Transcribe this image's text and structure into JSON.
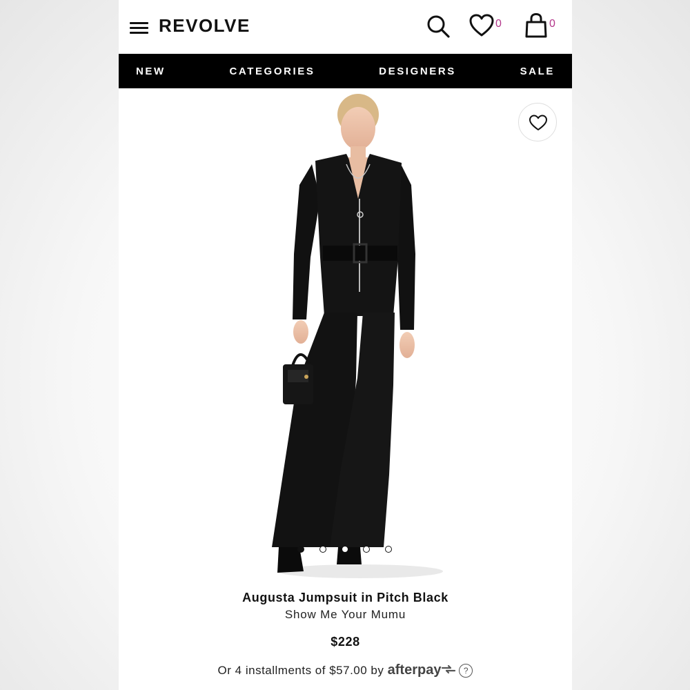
{
  "header": {
    "logo": "REVOLVE",
    "wishlist_count": "0",
    "bag_count": "0",
    "icons": [
      "menu-icon",
      "search-icon",
      "heart-icon",
      "bag-icon"
    ]
  },
  "nav": {
    "items": [
      {
        "label": "NEW"
      },
      {
        "label": "CATEGORIES"
      },
      {
        "label": "DESIGNERS"
      },
      {
        "label": "SALE"
      }
    ]
  },
  "gallery": {
    "image_count": 5,
    "active_index": 0,
    "favorite_icon": "heart-outline-icon"
  },
  "product": {
    "title": "Augusta Jumpsuit in Pitch Black",
    "brand": "Show Me Your Mumu",
    "price": "$228",
    "installments_text": "Or 4 installments of $57.00 by",
    "afterpay_label": "afterpay",
    "info_label": "?"
  },
  "colors": {
    "nav_bg": "#000000",
    "count_accent": "#b3368a"
  }
}
